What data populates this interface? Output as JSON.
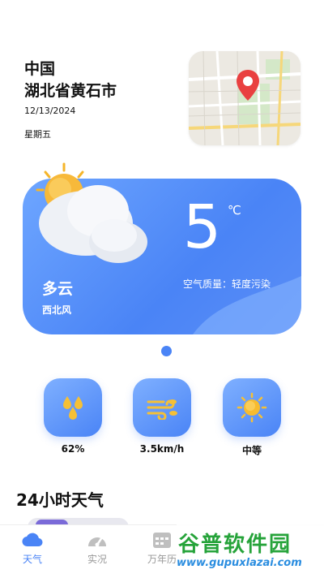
{
  "location": {
    "country": "中国",
    "province_city": "湖北省黄石市",
    "date": "12/13/2024",
    "weekday": "星期五"
  },
  "map": {
    "icon": "map-pin-icon",
    "pin_color": "#e94040"
  },
  "current": {
    "temperature": "5",
    "unit": "℃",
    "condition": "多云",
    "wind_direction": "西北风",
    "air_quality": "空气质量：轻度污染",
    "icon": "partly-cloudy-icon"
  },
  "stats": [
    {
      "icon": "humidity-drops-icon",
      "value": "62%"
    },
    {
      "icon": "wind-icon",
      "value": "3.5km/h"
    },
    {
      "icon": "sun-icon",
      "value": "中等"
    }
  ],
  "section": {
    "hourly_title": "24小时天气"
  },
  "tabs": [
    {
      "label": "天气",
      "icon": "cloud-icon",
      "active": true
    },
    {
      "label": "实况",
      "icon": "gauge-icon",
      "active": false
    },
    {
      "label": "万年历",
      "icon": "calendar-icon",
      "active": false
    }
  ],
  "watermark": {
    "main": "谷普软件园",
    "sub": "www.gupuxlazai.com"
  },
  "colors": {
    "accent": "#4a84f6",
    "card_light": "#6ea6ff",
    "watermark_green": "#26a33a"
  }
}
